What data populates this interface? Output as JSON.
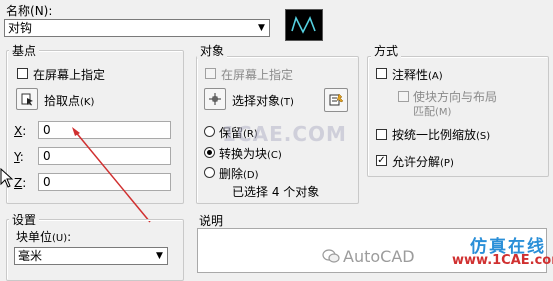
{
  "name": {
    "label": "名称",
    "shortcut": "(N)",
    "value": "对钩"
  },
  "base_point": {
    "title": "基点",
    "specify_on_screen": "在屏幕上指定",
    "pick_point": "拾取点",
    "pick_point_key": "(K)",
    "x_label": "X",
    "x_value": "0",
    "y_label": "Y",
    "y_value": "0",
    "z_label": "Z",
    "z_value": "0"
  },
  "objects": {
    "title": "对象",
    "specify_on_screen": "在屏幕上指定",
    "select_objects": "选择对象",
    "select_objects_key": "(T)",
    "retain": "保留",
    "retain_key": "(R)",
    "convert": "转换为块",
    "convert_key": "(C)",
    "delete": "删除",
    "delete_key": "(D)",
    "selected_count": "已选择 4 个对象"
  },
  "behavior": {
    "title": "方式",
    "annotative": "注释性",
    "annotative_key": "(A)",
    "match_orientation_line1": "使块方向与布局",
    "match_orientation_line2": "匹配",
    "match_orientation_key": "(M)",
    "scale_uniformly": "按统一比例缩放",
    "scale_uniformly_key": "(S)",
    "allow_exploding": "允许分解",
    "allow_exploding_key": "(P)",
    "allow_exploding_checked": true
  },
  "settings": {
    "title": "设置",
    "block_unit_label": "块单位",
    "block_unit_key": "(U)",
    "block_unit_value": "毫米"
  },
  "description": {
    "title": "说明"
  },
  "watermarks": {
    "center": "1CAE.COM",
    "bottom_brand": "仿真在线",
    "bottom_url": "www.1CAE.com",
    "bottom_account": "AutoCAD"
  }
}
